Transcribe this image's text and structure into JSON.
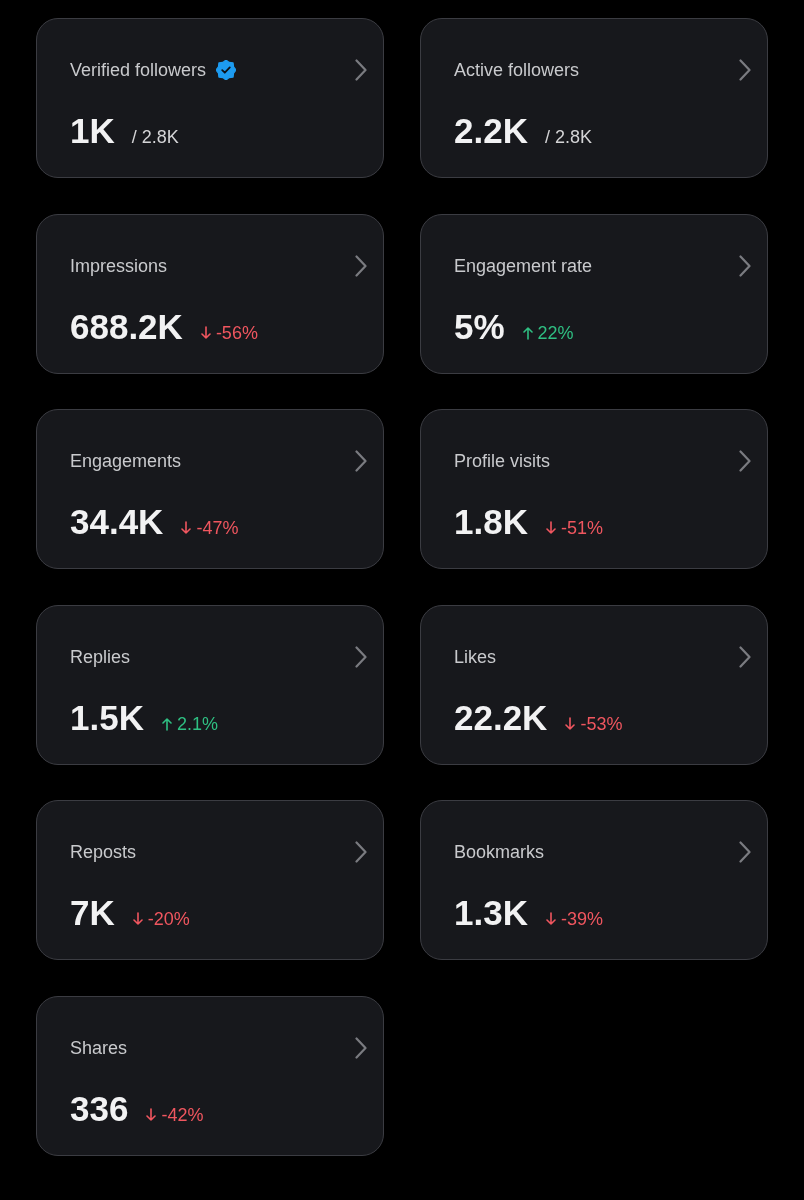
{
  "cards": [
    {
      "label": "Verified followers",
      "verified": true,
      "value": "1K",
      "total": "/ 2.8K"
    },
    {
      "label": "Active followers",
      "verified": false,
      "value": "2.2K",
      "total": "/ 2.8K"
    },
    {
      "label": "Impressions",
      "verified": false,
      "value": "688.2K",
      "change": {
        "rising": false,
        "text": "-56%"
      }
    },
    {
      "label": "Engagement rate",
      "verified": false,
      "value": "5%",
      "change": {
        "rising": true,
        "text": "22%"
      }
    },
    {
      "label": "Engagements",
      "verified": false,
      "value": "34.4K",
      "change": {
        "rising": false,
        "text": "-47%"
      }
    },
    {
      "label": "Profile visits",
      "verified": false,
      "value": "1.8K",
      "change": {
        "rising": false,
        "text": "-51%"
      }
    },
    {
      "label": "Replies",
      "verified": false,
      "value": "1.5K",
      "change": {
        "rising": true,
        "text": "2.1%"
      }
    },
    {
      "label": "Likes",
      "verified": false,
      "value": "22.2K",
      "change": {
        "rising": false,
        "text": "-53%"
      }
    },
    {
      "label": "Reposts",
      "verified": false,
      "value": "7K",
      "change": {
        "rising": false,
        "text": "-20%"
      }
    },
    {
      "label": "Bookmarks",
      "verified": false,
      "value": "1.3K",
      "change": {
        "rising": false,
        "text": "-39%"
      }
    },
    {
      "label": "Shares",
      "verified": false,
      "value": "336",
      "change": {
        "rising": false,
        "text": "-42%"
      }
    }
  ]
}
